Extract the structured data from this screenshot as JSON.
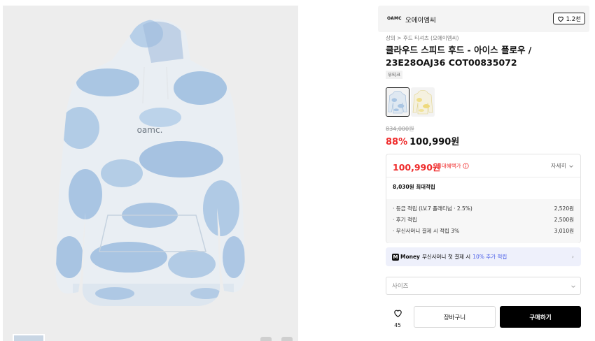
{
  "brand": {
    "logo_text": "OAMC",
    "name": "오에이엠씨",
    "likes": "1.2천"
  },
  "breadcrumb": "상의 > 후드 티셔츠 (오에이엠씨)",
  "product": {
    "title": "클라우드 스피드 후드 - 아이스 플로우 / 23E28OAJ36 COT00835072",
    "tag": "부티크",
    "original_price": "834,000원",
    "discount": "88%",
    "sale_price": "100,990원"
  },
  "benefits": {
    "max_price": "100,990원",
    "max_label": "최대혜택가",
    "detail_label": "자세히",
    "max_accrue": "8,030원 최대적립",
    "lines": [
      {
        "label": "· 등급 적립 (LV.7 플래티넘 · 2.5%)",
        "value": "2,520원"
      },
      {
        "label": "· 후기 적립",
        "value": "2,500원"
      },
      {
        "label": "· 무신사머니 결제 시 적립 3%",
        "value": "3,010원"
      }
    ]
  },
  "money_promo": {
    "logo": "Money",
    "text": "무신사머니 첫 결제 시",
    "accent": "10% 추가 적립"
  },
  "size_select": {
    "placeholder": "사이즈"
  },
  "actions": {
    "like_count": "45",
    "cart": "장바구니",
    "buy": "구매하기"
  },
  "hoodie_print": "oamc.",
  "icons": [
    "heart-icon",
    "info-icon",
    "chevron-down-icon",
    "chevron-right-icon",
    "money-logo-icon"
  ],
  "colors": {
    "sale_red": "#ef2c2c",
    "money_blue": "#4b5fe8",
    "buy_black": "#000000",
    "money_bg": "#eef0fb"
  }
}
